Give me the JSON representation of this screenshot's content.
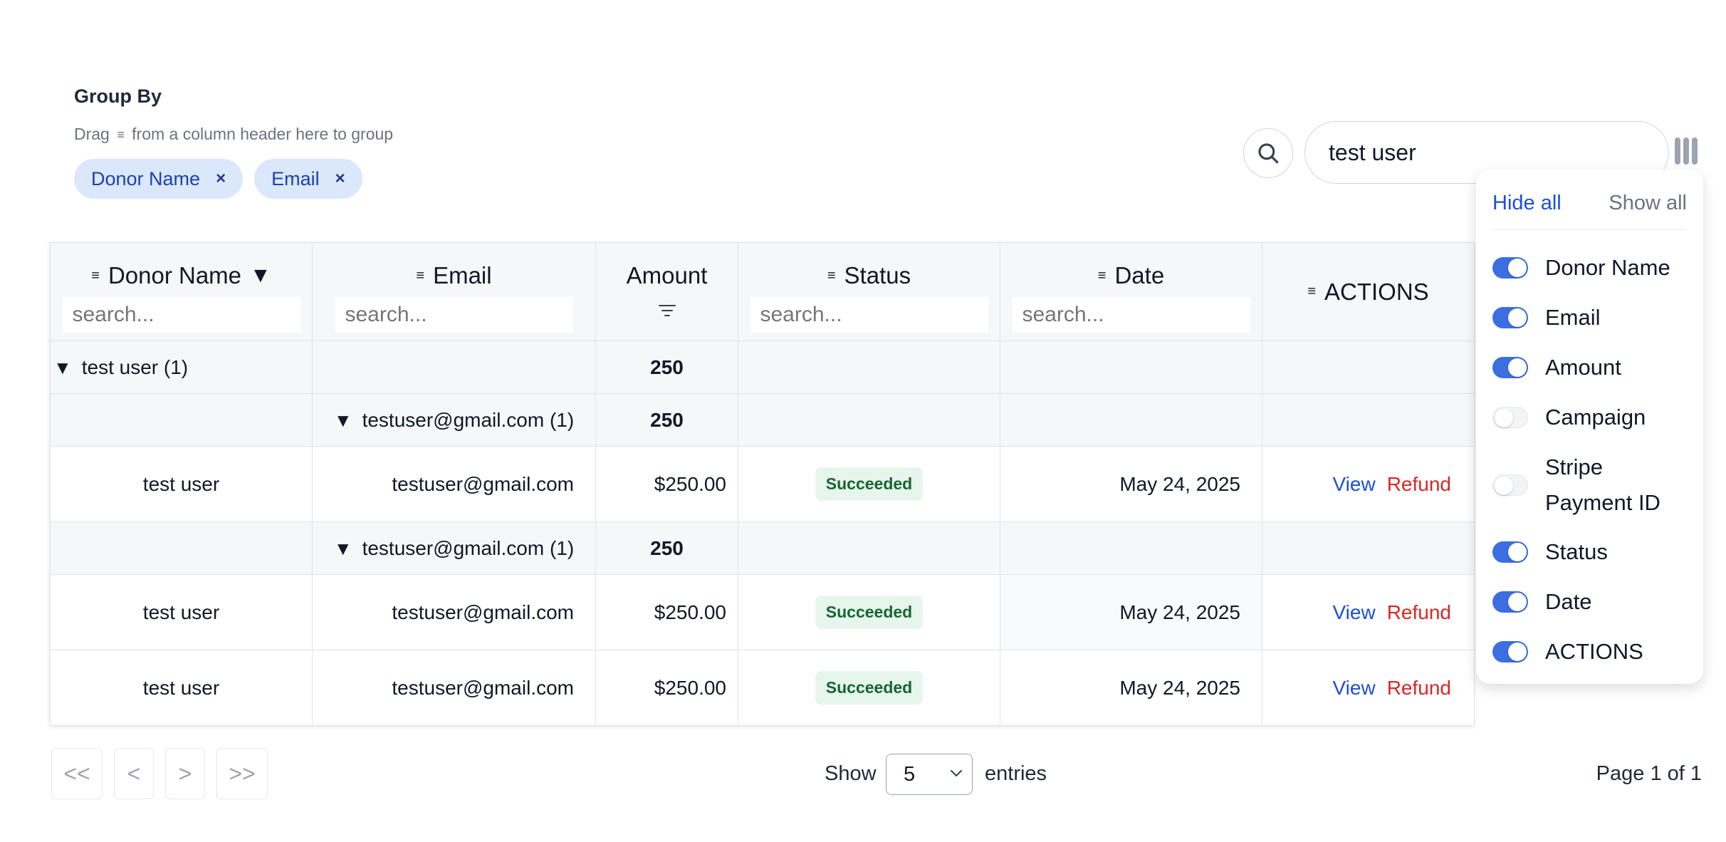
{
  "group_by": {
    "title": "Group By",
    "hint_before": "Drag",
    "hint_icon": "≡",
    "hint_after": "from a column header here to group",
    "chips": [
      {
        "label": "Donor Name",
        "remove": "×"
      },
      {
        "label": "Email",
        "remove": "×"
      }
    ]
  },
  "search": {
    "value": "test user",
    "icon": "search-icon"
  },
  "table": {
    "grip": "≡",
    "headers": {
      "donor_name": "Donor Name",
      "email": "Email",
      "amount": "Amount",
      "status": "Status",
      "date": "Date",
      "actions": "ACTIONS"
    },
    "sort_indicator": "▼",
    "search_placeholder": "search...",
    "group_row": {
      "label": "test user (1)",
      "amount": "250"
    },
    "subgroups": [
      {
        "label": "testuser@gmail.com (1)",
        "amount": "250",
        "rows": [
          {
            "name": "test user",
            "email": "testuser@gmail.com",
            "amount": "$250.00",
            "status": "Succeeded",
            "date": "May 24, 2025",
            "view": "View",
            "refund": "Refund"
          }
        ]
      },
      {
        "label": "testuser@gmail.com (1)",
        "amount": "250",
        "rows": [
          {
            "name": "test user",
            "email": "testuser@gmail.com",
            "amount": "$250.00",
            "status": "Succeeded",
            "date": "May 24, 2025",
            "view": "View",
            "refund": "Refund"
          },
          {
            "name": "test user",
            "email": "testuser@gmail.com",
            "amount": "$250.00",
            "status": "Succeeded",
            "date": "May 24, 2025",
            "view": "View",
            "refund": "Refund"
          }
        ]
      }
    ]
  },
  "pagination": {
    "first": "<<",
    "prev": "<",
    "next": ">",
    "last": ">>",
    "show": "Show",
    "page_size": "5",
    "entries": "entries",
    "page_info": "Page 1 of 1"
  },
  "column_panel": {
    "hide_all": "Hide all",
    "show_all": "Show all",
    "columns": [
      {
        "label": "Donor Name",
        "visible": true
      },
      {
        "label": "Email",
        "visible": true
      },
      {
        "label": "Amount",
        "visible": true
      },
      {
        "label": "Campaign",
        "visible": false
      },
      {
        "label": "Stripe Payment ID",
        "visible": false
      },
      {
        "label": "Status",
        "visible": true
      },
      {
        "label": "Date",
        "visible": true
      },
      {
        "label": "ACTIONS",
        "visible": true
      }
    ]
  },
  "colors": {
    "accent": "#3b6ee0",
    "link": "#1d4ed8",
    "danger": "#dc2626",
    "success_bg": "#e7f6ed",
    "success_text": "#166534",
    "chip_bg": "#dbe7fb"
  }
}
